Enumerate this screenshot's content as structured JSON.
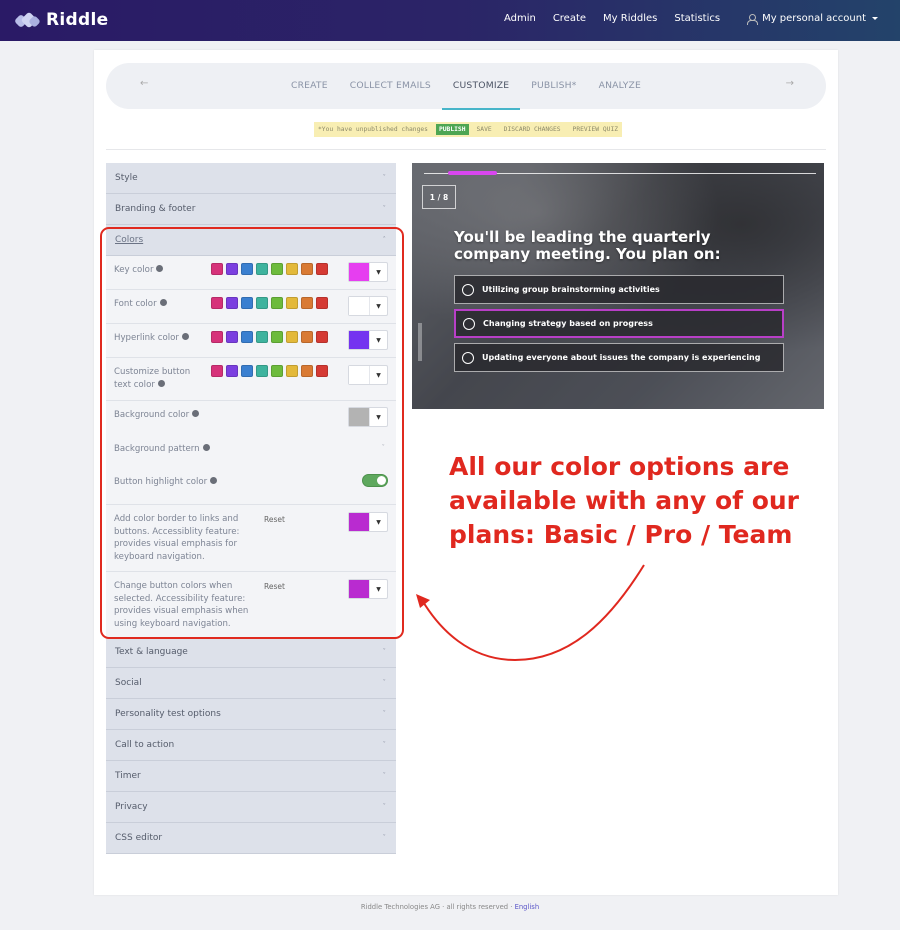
{
  "header": {
    "brand": "Riddle",
    "nav": [
      "Admin",
      "Create",
      "My Riddles",
      "Statistics"
    ],
    "account_label": "My personal account"
  },
  "steps": {
    "prev_icon": "arrow-left",
    "next_icon": "arrow-right",
    "items": [
      {
        "label": "CREATE",
        "active": false
      },
      {
        "label": "COLLECT EMAILS",
        "active": false
      },
      {
        "label": "CUSTOMIZE",
        "active": true
      },
      {
        "label": "PUBLISH*",
        "active": false
      },
      {
        "label": "ANALYZE",
        "active": false
      }
    ]
  },
  "unsaved_bar": {
    "message": "*You have unpublished changes",
    "publish": "PUBLISH",
    "save": "SAVE",
    "discard": "DISCARD CHANGES",
    "preview": "PREVIEW QUIZ"
  },
  "panel": {
    "sections_top": [
      "Style",
      "Branding & footer"
    ],
    "colors_title": "Colors",
    "palette": [
      "#d6327a",
      "#7b3fe0",
      "#3a7fd0",
      "#3eb39e",
      "#6dbb3d",
      "#e3b93a",
      "#d97a34",
      "#d53a34"
    ],
    "rows": {
      "key_color": {
        "label": "Key color",
        "value": "#e63ef0"
      },
      "font_color": {
        "label": "Font color",
        "value": "#ffffff"
      },
      "hyperlink_color": {
        "label": "Hyperlink color",
        "value": "#7433f0"
      },
      "button_text_color": {
        "label1": "Customize button",
        "label2": "text color",
        "value": "#ffffff"
      },
      "background_color": {
        "label": "Background color",
        "value": "#b3b3b3"
      },
      "background_pattern": {
        "label": "Background pattern"
      },
      "button_highlight": {
        "label": "Button highlight color",
        "enabled": true
      },
      "border_links": {
        "lines": [
          "Add color border to links and",
          "buttons. Accessiblity feature:",
          "provides visual emphasis for",
          "keyboard navigation."
        ],
        "reset": "Reset",
        "value": "#b92bd0"
      },
      "selected_buttons": {
        "lines": [
          "Change button colors when",
          "selected. Accessibility feature:",
          "provides visual emphasis when",
          "using keyboard navigation."
        ],
        "reset": "Reset",
        "value": "#b92bd0"
      }
    },
    "sections_bottom": [
      "Text & language",
      "Social",
      "Personality test options",
      "Call to action",
      "Timer",
      "Privacy",
      "CSS editor"
    ]
  },
  "preview": {
    "progress_fraction": 0.125,
    "progress_color": "#d946ef",
    "counter": "1 / 8",
    "question": "You'll be leading the quarterly company meeting. You plan on:",
    "answers": [
      {
        "text": "Utilizing group brainstorming activities",
        "selected": false
      },
      {
        "text": "Changing strategy based on progress",
        "selected": true
      },
      {
        "text": "Updating everyone about issues the company is experiencing",
        "selected": false
      }
    ]
  },
  "callout": {
    "lines": [
      "All our color options are",
      "available with any of our",
      "plans: Basic / Pro / Team"
    ],
    "color": "#e0281f"
  },
  "footer": {
    "text": "Riddle Technologies AG · all rights reserved ·",
    "language": "English"
  }
}
